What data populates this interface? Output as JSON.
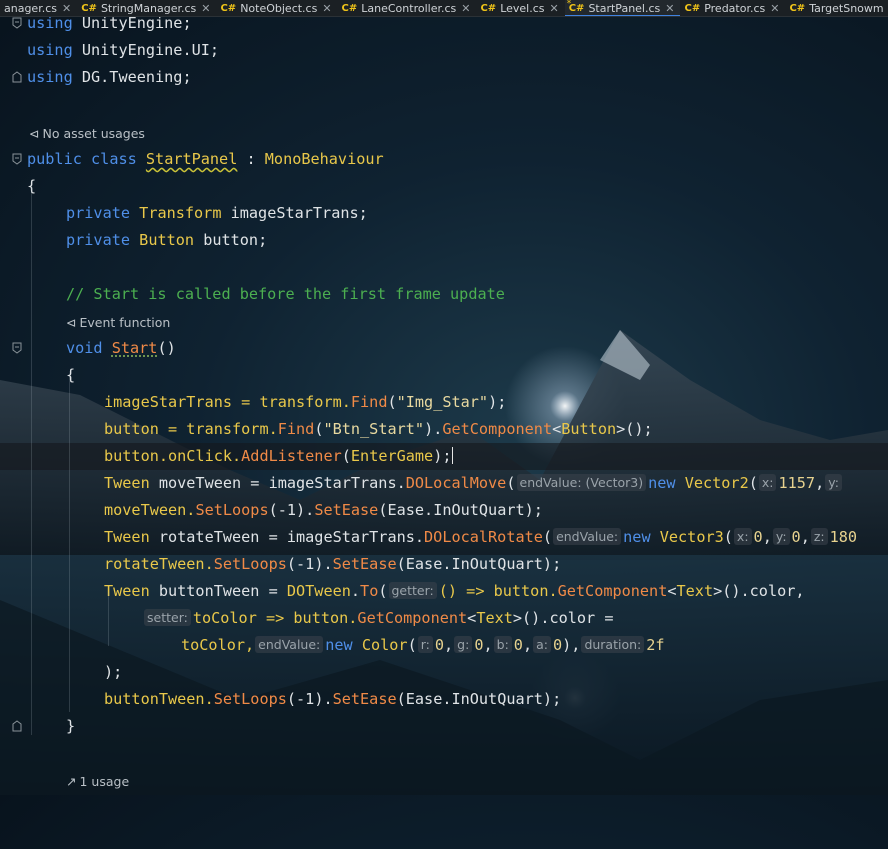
{
  "tabs": [
    {
      "label": "anager.cs",
      "active": false,
      "modified": false
    },
    {
      "label": "StringManager.cs",
      "active": false,
      "modified": false
    },
    {
      "label": "NoteObject.cs",
      "active": false,
      "modified": false
    },
    {
      "label": "LaneController.cs",
      "active": false,
      "modified": false
    },
    {
      "label": "Level.cs",
      "active": false,
      "modified": false
    },
    {
      "label": "StartPanel.cs",
      "active": true,
      "modified": true
    },
    {
      "label": "Predator.cs",
      "active": false,
      "modified": false
    },
    {
      "label": "TargetSnowm",
      "active": false,
      "modified": false
    }
  ],
  "tab_lang_badge": "C#",
  "tab_modified_marker": "*",
  "tab_close_glyph": "✕",
  "hints": {
    "no_asset_usages": "No asset usages",
    "event_function": "Event function",
    "one_usage": "1 usage"
  },
  "code": {
    "using1_kw": "using",
    "using1_ns": "UnityEngine;",
    "using2_kw": "using",
    "using2_ns": "UnityEngine.UI;",
    "using3_kw": "using",
    "using3_ns": "DG.Tweening;",
    "class_public": "public",
    "class_kw": "class",
    "class_name": "StartPanel",
    "class_colon": " : ",
    "class_base": "MonoBehaviour",
    "brace_open": "{",
    "brace_close": "}",
    "f1_private": "private",
    "f1_type": "Transform",
    "f1_name": "imageStarTrans;",
    "f2_private": "private",
    "f2_type": "Button",
    "f2_name": "button;",
    "comment": "// Start is called before the first frame update",
    "start_void": "void",
    "start_name": "Start",
    "start_parens": "()",
    "l1_a": "imageStarTrans = transform.",
    "l1_find": "Find",
    "l1_b": "(",
    "l1_str": "\"Img_Star\"",
    "l1_c": ");",
    "l2_a": "button = transform.",
    "l2_find": "Find",
    "l2_b": "(",
    "l2_str": "\"Btn_Start\"",
    "l2_c": ").",
    "l2_gc": "GetComponent",
    "l2_lt": "<",
    "l2_ty": "Button",
    "l2_d": ">();",
    "l3_a": "button.onClick.",
    "l3_m": "AddListener",
    "l3_b": "(",
    "l3_arg": "EnterGame",
    "l3_c": ");",
    "l4_ty": "Tween",
    "l4_a": " moveTween = imageStarTrans.",
    "l4_m": "DOLocalMove",
    "l4_b": "(",
    "l4_ph": "endValue: (Vector3)",
    "l4_new": "new",
    "l4_v2": "Vector2",
    "l4_c": "(",
    "l4_phx": "x:",
    "l4_n": "1157",
    "l4_d": ",",
    "l4_phy": "y:",
    "l5_a": "moveTween.",
    "l5_m1": "SetLoops",
    "l5_b": "(-1).",
    "l5_m2": "SetEase",
    "l5_c": "(Ease.InOutQuart);",
    "l6_ty": "Tween",
    "l6_a": " rotateTween = imageStarTrans.",
    "l6_m": "DOLocalRotate",
    "l6_b": "(",
    "l6_ph": "endValue:",
    "l6_new": "new",
    "l6_v3": "Vector3",
    "l6_c": "(",
    "l6_phx": "x:",
    "l6_n1": "0",
    "l6_d": ",",
    "l6_phy": "y:",
    "l6_n2": "0",
    "l6_e": ",",
    "l6_phz": "z:",
    "l6_n3": "180",
    "l7_a": "rotateTween.",
    "l7_m1": "SetLoops",
    "l7_b": "(-1).",
    "l7_m2": "SetEase",
    "l7_c": "(Ease.InOutQuart);",
    "l8_ty": "Tween",
    "l8_a": " buttonTween = ",
    "l8_dt": "DOTween",
    "l8_b": ".",
    "l8_to": "To",
    "l8_c": "(",
    "l8_ph": "getter:",
    "l8_d": "() => button.",
    "l8_gc": "GetComponent",
    "l8_lt": "<",
    "l8_tx": "Text",
    "l8_e": ">().color,",
    "l9_ph": "setter:",
    "l9_a": "toColor => button.",
    "l9_gc": "GetComponent",
    "l9_lt": "<",
    "l9_tx": "Text",
    "l9_b": ">().color =",
    "l10_a": "toColor,",
    "l10_ph": "endValue:",
    "l10_new": "new",
    "l10_col": "Color",
    "l10_b": "(",
    "l10_phr": "r:",
    "l10_n1": "0",
    "l10_c1": ",",
    "l10_phg": "g:",
    "l10_n2": "0",
    "l10_c2": ",",
    "l10_phb": "b:",
    "l10_n3": "0",
    "l10_c3": ",",
    "l10_pha": "a:",
    "l10_n4": "0",
    "l10_c4": "),",
    "l10_phd": "duration:",
    "l10_n5": "2f",
    "l11": ");",
    "l12_a": "buttonTween.",
    "l12_m1": "SetLoops",
    "l12_b": "(-1).",
    "l12_m2": "SetEase",
    "l12_c": "(Ease.InOutQuart);"
  }
}
